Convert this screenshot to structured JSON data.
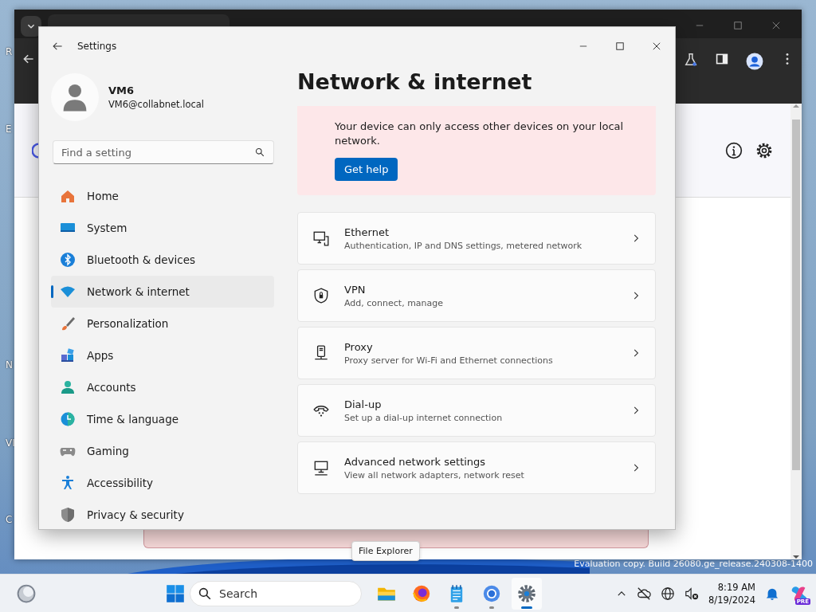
{
  "desktop": {
    "icon_labels": [
      "R",
      "E",
      "N",
      "VI",
      "C"
    ],
    "watermark": "Evaluation copy. Build 26080.ge_release.240308-1400"
  },
  "settings": {
    "title": "Settings",
    "user": {
      "name": "VM6",
      "email": "VM6@collabnet.local"
    },
    "search": {
      "placeholder": "Find a setting"
    },
    "nav": [
      {
        "label": "Home",
        "kind": "home",
        "selected": false
      },
      {
        "label": "System",
        "kind": "system",
        "selected": false
      },
      {
        "label": "Bluetooth & devices",
        "kind": "bluetooth",
        "selected": false
      },
      {
        "label": "Network & internet",
        "kind": "network",
        "selected": true
      },
      {
        "label": "Personalization",
        "kind": "personalization",
        "selected": false
      },
      {
        "label": "Apps",
        "kind": "apps",
        "selected": false
      },
      {
        "label": "Accounts",
        "kind": "accounts",
        "selected": false
      },
      {
        "label": "Time & language",
        "kind": "time",
        "selected": false
      },
      {
        "label": "Gaming",
        "kind": "gaming",
        "selected": false
      },
      {
        "label": "Accessibility",
        "kind": "accessibility",
        "selected": false
      },
      {
        "label": "Privacy & security",
        "kind": "privacy",
        "selected": false
      }
    ],
    "page_title": "Network & internet",
    "banner": {
      "message": "Your device can only access other devices on your local network.",
      "button": "Get help"
    },
    "cards": [
      {
        "kind": "ethernet",
        "title": "Ethernet",
        "subtitle": "Authentication, IP and DNS settings, metered network"
      },
      {
        "kind": "vpn",
        "title": "VPN",
        "subtitle": "Add, connect, manage"
      },
      {
        "kind": "proxy",
        "title": "Proxy",
        "subtitle": "Proxy server for Wi-Fi and Ethernet connections"
      },
      {
        "kind": "dialup",
        "title": "Dial-up",
        "subtitle": "Set up a dial-up internet connection"
      },
      {
        "kind": "advanced",
        "title": "Advanced network settings",
        "subtitle": "View all network adapters, network reset"
      }
    ]
  },
  "tooltip": "File Explorer",
  "taskbar": {
    "search_placeholder": "Search",
    "apps": [
      {
        "kind": "explorer",
        "running": false,
        "selected": false
      },
      {
        "kind": "firefox",
        "running": false,
        "selected": false
      },
      {
        "kind": "notepad",
        "running": true,
        "selected": false
      },
      {
        "kind": "chrome",
        "running": true,
        "selected": false
      },
      {
        "kind": "settings",
        "running": true,
        "selected": true
      }
    ],
    "time": "8:19 AM",
    "date": "8/19/2024",
    "copilot_badge": "PRE"
  }
}
